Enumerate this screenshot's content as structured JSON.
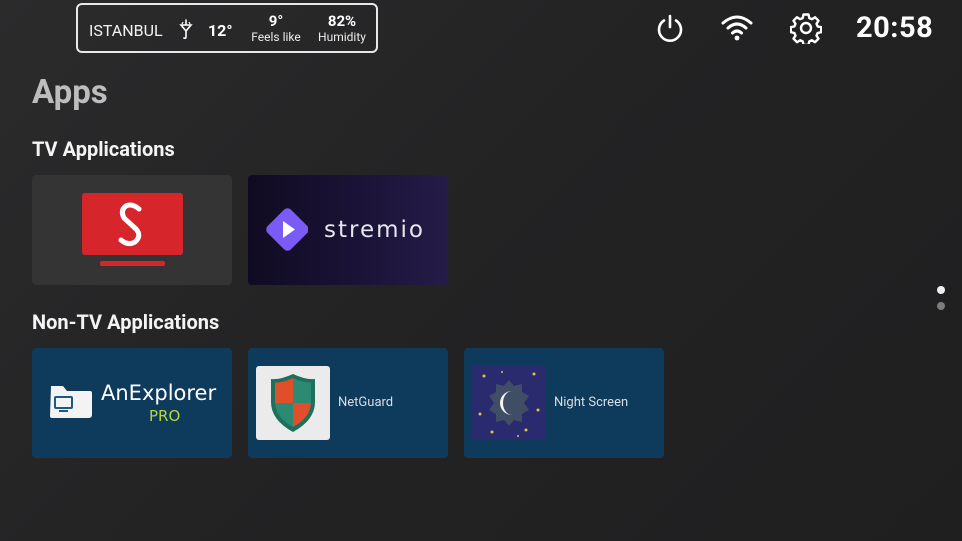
{
  "weather": {
    "city": "ISTANBUL",
    "temperature": "12°",
    "feels_like_value": "9°",
    "feels_like_label": "Feels like",
    "humidity_value": "82%",
    "humidity_label": "Humidity",
    "icon": "rain-umbrella-icon"
  },
  "status_bar": {
    "icons": [
      "power-icon",
      "wifi-icon",
      "gear-icon"
    ],
    "time": "20:58"
  },
  "page": {
    "title": "Apps"
  },
  "sections": [
    {
      "title": "TV Applications",
      "apps": [
        {
          "name": "S TV app",
          "icon": "s-tv-icon",
          "color": "#d7262b"
        },
        {
          "name": "Stremio",
          "wordmark": "stremio",
          "color": "#7b5bf5"
        }
      ]
    },
    {
      "title": "Non-TV Applications",
      "apps": [
        {
          "name": "AnExplorer PRO",
          "wordmark": "AnExplorer",
          "sub": "PRO"
        },
        {
          "name": "NetGuard",
          "label": "NetGuard",
          "icon": "shield-icon"
        },
        {
          "name": "Night Screen",
          "label": "Night Screen",
          "icon": "moon-icon"
        }
      ]
    }
  ],
  "page_indicator": {
    "pages": 2,
    "current": 1
  },
  "colors": {
    "tile_blue": "#0e3a5c",
    "background": "#242425"
  }
}
